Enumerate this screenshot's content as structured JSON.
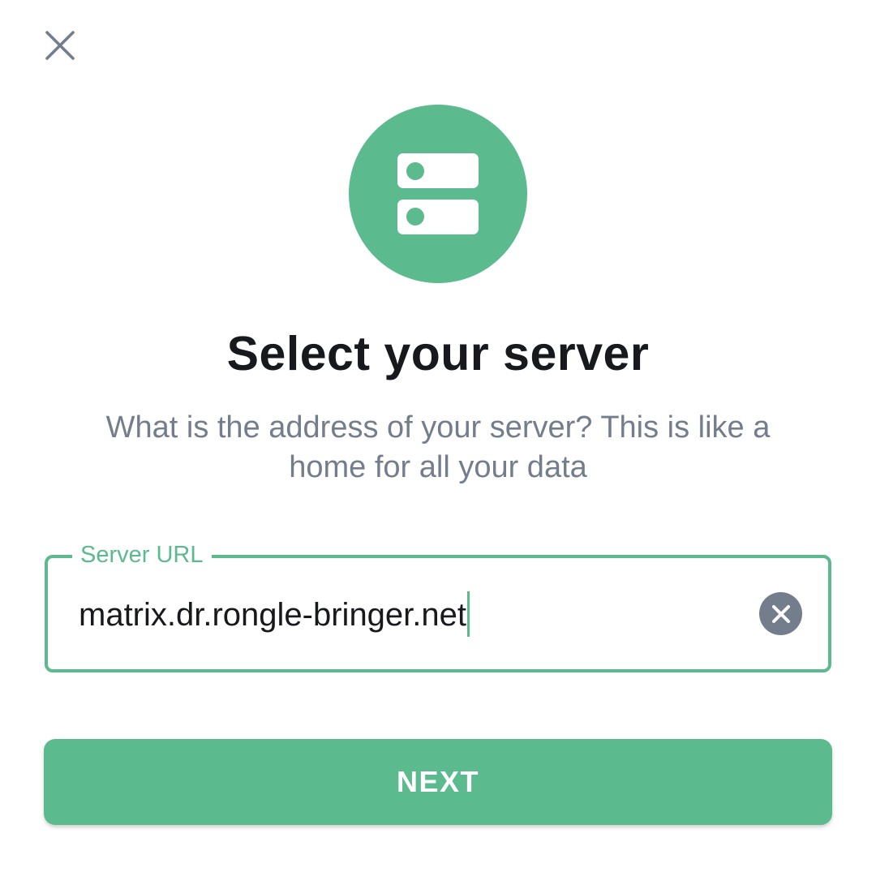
{
  "header": {
    "close_icon": "close-icon"
  },
  "hero": {
    "icon": "server-icon",
    "color": "#5bba8e"
  },
  "title": "Select your server",
  "subtitle": "What is the address of your server? This is like a home for all your data",
  "server_field": {
    "label": "Server URL",
    "value": "matrix.dr.rongle-bringer.net",
    "clear_icon": "clear-icon"
  },
  "next_button": {
    "label": "NEXT"
  },
  "colors": {
    "accent": "#5bba8e",
    "text_primary": "#17191c",
    "text_secondary": "#737d8c",
    "background": "#ffffff"
  }
}
